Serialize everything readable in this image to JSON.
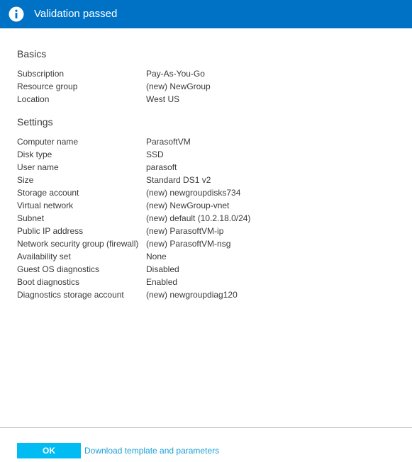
{
  "banner": {
    "title": "Validation passed",
    "icon": "info-icon",
    "color": "#0072c6"
  },
  "basics": {
    "title": "Basics",
    "rows": [
      {
        "label": "Subscription",
        "value": "Pay-As-You-Go"
      },
      {
        "label": "Resource group",
        "value": "(new) NewGroup"
      },
      {
        "label": "Location",
        "value": "West US"
      }
    ]
  },
  "settings": {
    "title": "Settings",
    "rows": [
      {
        "label": "Computer name",
        "value": "ParasoftVM"
      },
      {
        "label": "Disk type",
        "value": "SSD"
      },
      {
        "label": "User name",
        "value": "parasoft"
      },
      {
        "label": "Size",
        "value": "Standard DS1 v2"
      },
      {
        "label": "Storage account",
        "value": "(new) newgroupdisks734"
      },
      {
        "label": "Virtual network",
        "value": "(new) NewGroup-vnet"
      },
      {
        "label": "Subnet",
        "value": "(new) default (10.2.18.0/24)"
      },
      {
        "label": "Public IP address",
        "value": "(new) ParasoftVM-ip"
      },
      {
        "label": "Network security group (firewall)",
        "value": "(new) ParasoftVM-nsg"
      },
      {
        "label": "Availability set",
        "value": "None"
      },
      {
        "label": "Guest OS diagnostics",
        "value": "Disabled"
      },
      {
        "label": "Boot diagnostics",
        "value": "Enabled"
      },
      {
        "label": "Diagnostics storage account",
        "value": "(new) newgroupdiag120"
      }
    ]
  },
  "footer": {
    "ok_label": "OK",
    "ok_color": "#00bcf2",
    "link_label": "Download template and parameters",
    "link_color": "#1a9fd4"
  }
}
